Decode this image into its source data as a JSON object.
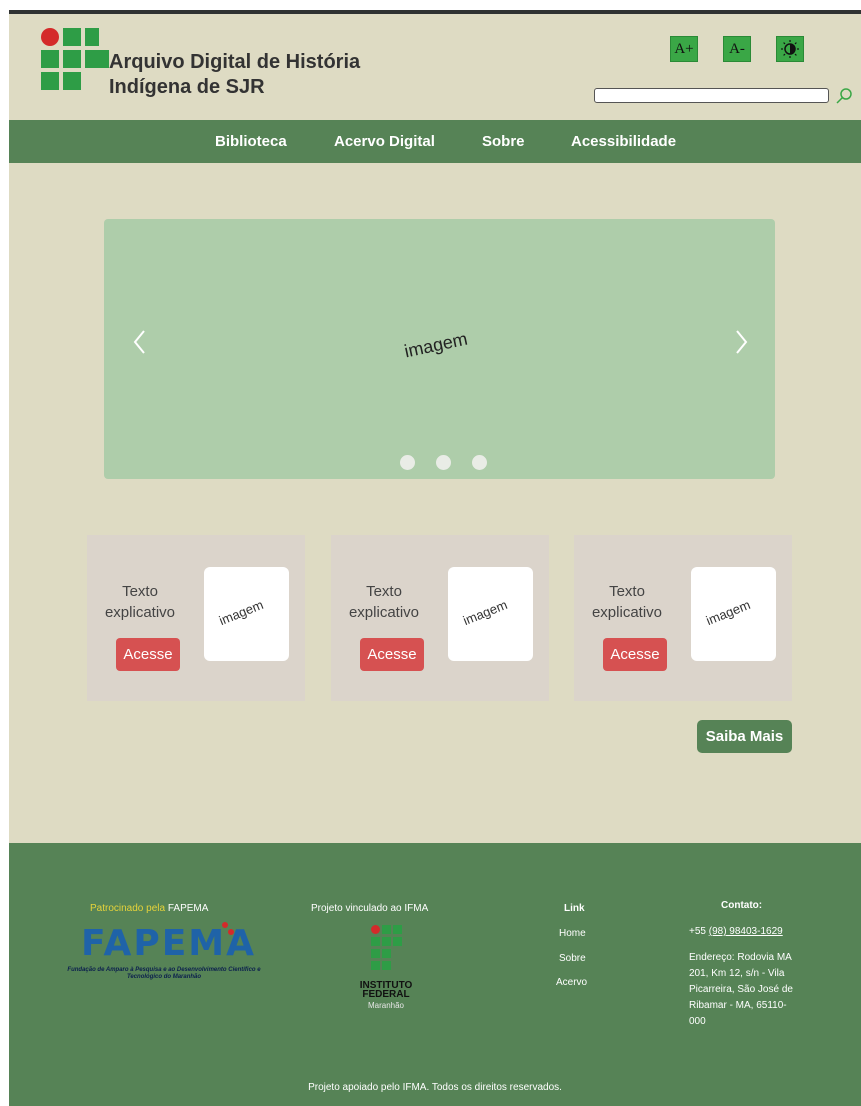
{
  "header": {
    "title_line1": "Arquivo Digital de História",
    "title_line2": "Indígena de SJR",
    "font_increase_label": "A+",
    "font_decrease_label": "A-",
    "contrast_icon": "contrast-icon",
    "search": {
      "value": "",
      "icon": "search-icon"
    }
  },
  "nav": {
    "items": [
      {
        "label": "Biblioteca"
      },
      {
        "label": "Acervo Digital"
      },
      {
        "label": "Sobre"
      },
      {
        "label": "Acessibilidade"
      }
    ]
  },
  "carousel": {
    "image_label": "imagem",
    "slides": 3,
    "prev_icon": "chevron-left-icon",
    "next_icon": "chevron-right-icon"
  },
  "cards": [
    {
      "text_line1": "Texto",
      "text_line2": "explicativo",
      "button": "Acesse",
      "image_label": "imagem"
    },
    {
      "text_line1": "Texto",
      "text_line2": "explicativo",
      "button": "Acesse",
      "image_label": "imagem"
    },
    {
      "text_line1": "Texto",
      "text_line2": "explicativo",
      "button": "Acesse",
      "image_label": "imagem"
    }
  ],
  "saiba_mais": "Saiba Mais",
  "footer": {
    "sponsor_prefix": "Patrocinado pela",
    "sponsor_name": "FAPEMA",
    "fapema_logo": "FAPEMA",
    "fapema_sub": "Fundação de Amparo à Pesquisa e ao Desenvolvimento Científico e Tecnológico do Maranhão",
    "linked": "Projeto vinculado ao IFMA",
    "if_name_line1": "INSTITUTO",
    "if_name_line2": "FEDERAL",
    "if_sub": "Maranhão",
    "links_title": "Link",
    "links": [
      {
        "label": "Home"
      },
      {
        "label": "Sobre"
      },
      {
        "label": "Acervo"
      }
    ],
    "contact_title": "Contato:",
    "phone_prefix": "+55",
    "phone": "(98) 98403-1629",
    "address": "Endereço: Rodovia MA 201, Km 12, s/n - Vila Picarreira, São José de Ribamar - MA, 65110-000",
    "copyright": "Projeto apoiado pelo IFMA. Todos os direitos reservados."
  },
  "colors": {
    "background": "#dedbc3",
    "nav_green": "#568356",
    "button_green": "#3aa746",
    "carousel": "#aecdaa",
    "card": "#dbd4cb",
    "cta_red": "#d65151"
  }
}
